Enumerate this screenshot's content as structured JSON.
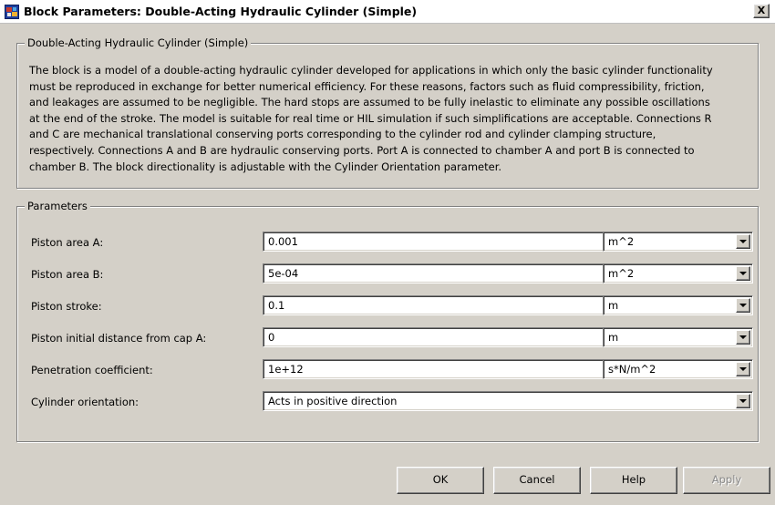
{
  "window": {
    "title": "Block Parameters: Double-Acting Hydraulic Cylinder (Simple)",
    "close_label": "X"
  },
  "description_group": {
    "legend": "Double-Acting Hydraulic Cylinder (Simple)",
    "lines": [
      "The block is a model of a double-acting hydraulic cylinder developed for applications in which only the basic cylinder functionality",
      "must be reproduced in exchange for better numerical efficiency. For these reasons, factors such as fluid compressibility, friction,",
      "and leakages are assumed to be negligible. The hard stops are assumed to be fully inelastic to eliminate any possible oscillations",
      "at the end of the stroke. The model is suitable for real time or HIL simulation if such simplifications are acceptable. Connections R",
      "and C are mechanical translational conserving ports corresponding to the cylinder rod and cylinder clamping structure,",
      "respectively. Connections A and B are hydraulic conserving ports. Port A is connected to chamber A and port B is connected to",
      "chamber B. The block directionality is adjustable with the Cylinder Orientation parameter."
    ]
  },
  "parameters_group": {
    "legend": "Parameters",
    "rows": [
      {
        "label": "Piston area A:",
        "value": "0.001",
        "unit": "m^2"
      },
      {
        "label": "Piston area B:",
        "value": "5e-04",
        "unit": "m^2"
      },
      {
        "label": "Piston stroke:",
        "value": "0.1",
        "unit": "m"
      },
      {
        "label": "Piston initial distance from cap A:",
        "value": "0",
        "unit": "m"
      },
      {
        "label": "Penetration coefficient:",
        "value": "1e+12",
        "unit": "s*N/m^2"
      }
    ],
    "orientation": {
      "label": "Cylinder orientation:",
      "value": "Acts in positive direction"
    }
  },
  "buttons": {
    "ok": "OK",
    "cancel": "Cancel",
    "help": "Help",
    "apply": "Apply"
  },
  "icons": {
    "app": "simulink-block-icon",
    "close": "close-icon",
    "dropdown": "chevron-down-icon"
  }
}
